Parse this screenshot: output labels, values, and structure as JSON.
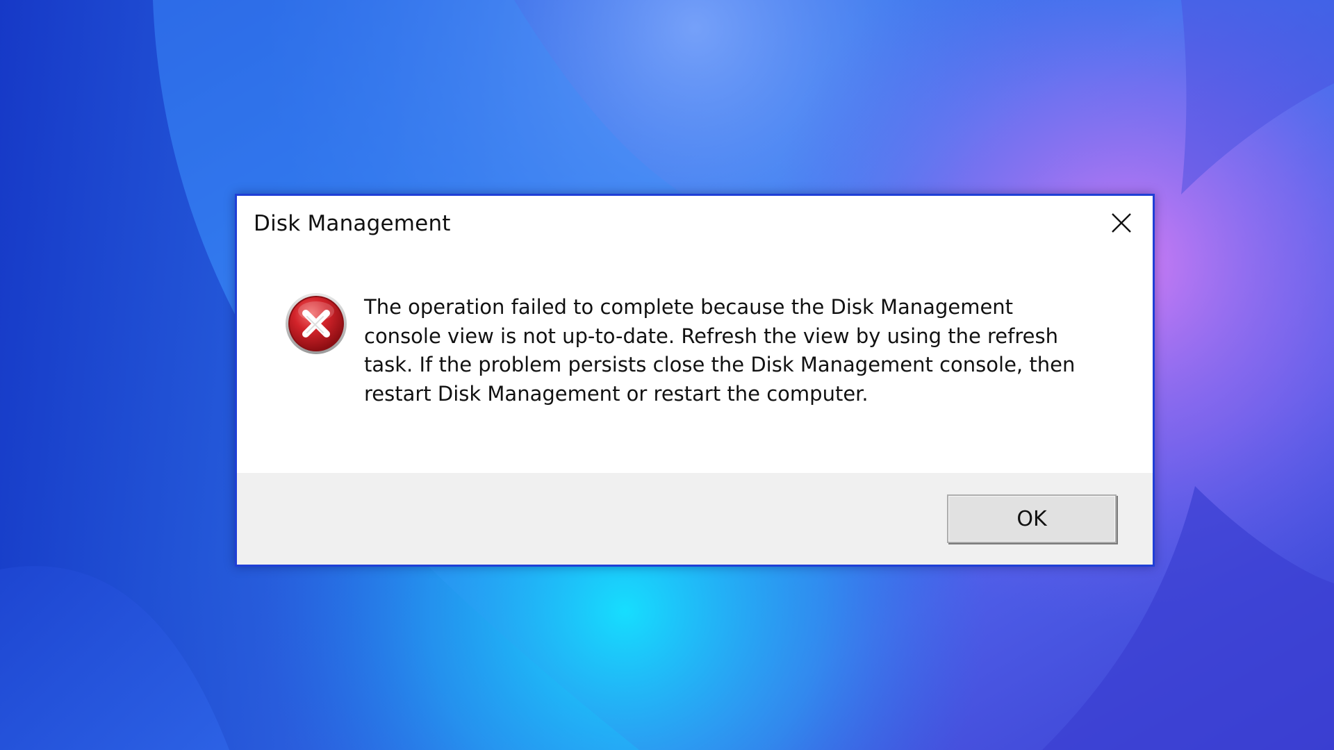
{
  "dialog": {
    "title": "Disk Management",
    "close_icon": "close-icon",
    "icon": "error-icon",
    "message": "The operation failed to complete because the Disk Management\nconsole view is not up-to-date.  Refresh the view by using the refresh\ntask. If the problem persists close the Disk Management console, then\nrestart Disk Management or restart the computer.",
    "ok_label": "OK"
  },
  "colors": {
    "dialog_border": "#1f3fd6",
    "footer_background": "#f0f0f0",
    "error_icon_red": "#c8141c"
  }
}
